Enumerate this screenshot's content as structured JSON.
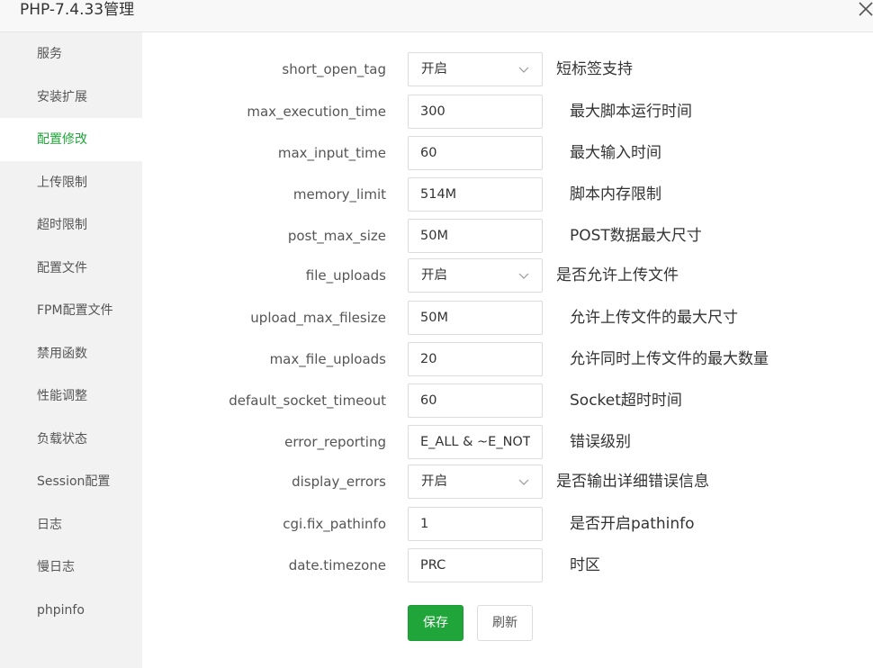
{
  "window": {
    "title": "PHP-7.4.33管理",
    "close_icon": "close-icon"
  },
  "sidebar": {
    "active_color": "#20a53a",
    "items": [
      {
        "label": "服务"
      },
      {
        "label": "安装扩展"
      },
      {
        "label": "配置修改"
      },
      {
        "label": "上传限制"
      },
      {
        "label": "超时限制"
      },
      {
        "label": "配置文件"
      },
      {
        "label": "FPM配置文件"
      },
      {
        "label": "禁用函数"
      },
      {
        "label": "性能调整"
      },
      {
        "label": "负载状态"
      },
      {
        "label": "Session配置"
      },
      {
        "label": "日志"
      },
      {
        "label": "慢日志"
      },
      {
        "label": "phpinfo"
      }
    ],
    "active_index": 2
  },
  "config": {
    "rows": [
      {
        "key": "short_open_tag",
        "value": "开启",
        "desc": "短标签支持"
      },
      {
        "key": "max_execution_time",
        "value": "300",
        "desc": "最大脚本运行时间"
      },
      {
        "key": "max_input_time",
        "value": "60",
        "desc": "最大输入时间"
      },
      {
        "key": "memory_limit",
        "value": "514M",
        "desc": "脚本内存限制"
      },
      {
        "key": "post_max_size",
        "value": "50M",
        "desc": "POST数据最大尺寸"
      },
      {
        "key": "file_uploads",
        "value": "开启",
        "desc": "是否允许上传文件"
      },
      {
        "key": "upload_max_filesize",
        "value": "50M",
        "desc": "允许上传文件的最大尺寸"
      },
      {
        "key": "max_file_uploads",
        "value": "20",
        "desc": "允许同时上传文件的最大数量"
      },
      {
        "key": "default_socket_timeout",
        "value": "60",
        "desc": "Socket超时时间"
      },
      {
        "key": "error_reporting",
        "value": "E_ALL & ~E_NOTICE",
        "desc": "错误级别"
      },
      {
        "key": "display_errors",
        "value": "开启",
        "desc": "是否输出详细错误信息"
      },
      {
        "key": "cgi.fix_pathinfo",
        "value": "1",
        "desc": "是否开启pathinfo"
      },
      {
        "key": "date.timezone",
        "value": "PRC",
        "desc": "时区"
      }
    ]
  },
  "actions": {
    "save_label": "保存",
    "refresh_label": "刷新",
    "save_color": "#20a53a"
  }
}
